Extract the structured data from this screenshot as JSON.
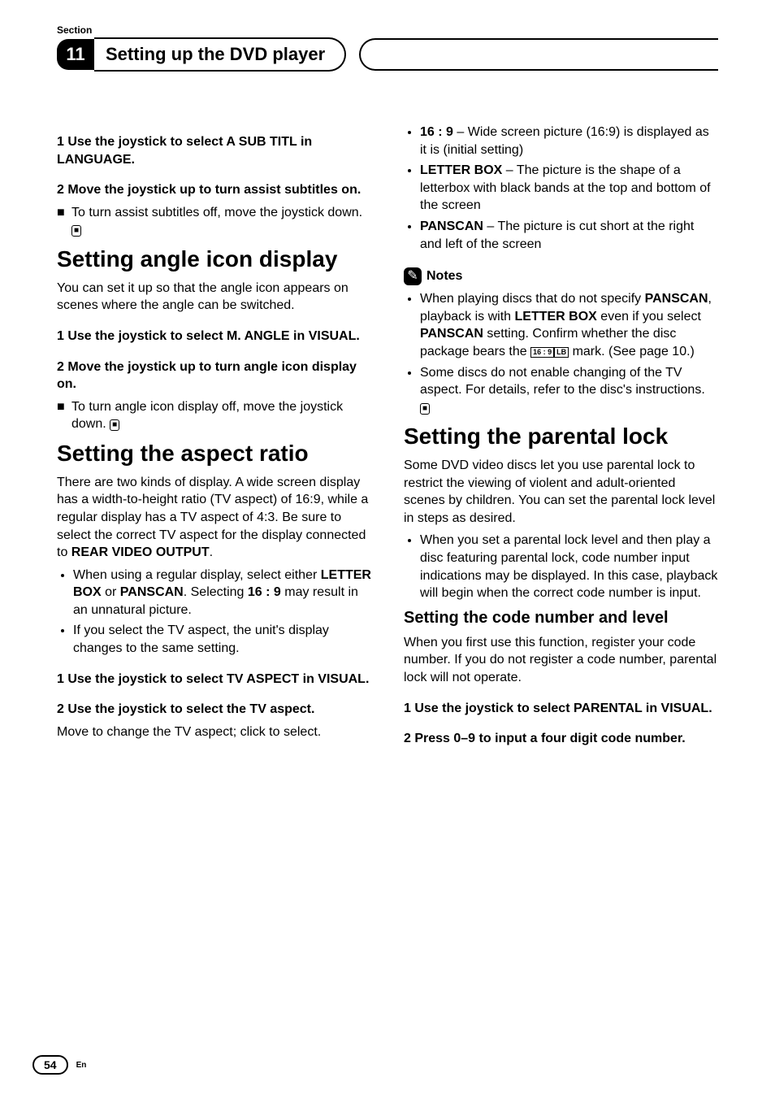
{
  "header": {
    "section_label": "Section",
    "section_number": "11",
    "chapter_title": "Setting up the DVD player"
  },
  "left": {
    "step_a_lead": "1     Use the joystick to select A SUB TITL in LANGUAGE.",
    "step_b_lead": "2     Move the joystick up to turn assist subtitles on.",
    "step_b_sub": "To turn assist subtitles off, move the joystick down.",
    "angle_h": "Setting angle icon display",
    "angle_intro": "You can set it up so that the angle icon appears on scenes where the angle can be switched.",
    "angle_s1": "1     Use the joystick to select M. ANGLE in VISUAL.",
    "angle_s2": "2     Move the joystick up to turn angle icon display on.",
    "angle_s2_sub": "To turn angle icon display off, move the joystick down.",
    "aspect_h": "Setting the aspect ratio",
    "aspect_p1a": "There are two kinds of display. A wide screen display has a width-to-height ratio (TV aspect) of 16:9, while a regular display has a TV aspect of 4:3. Be sure to select the correct TV aspect for the display connected to ",
    "aspect_p1b": "REAR VIDEO OUTPUT",
    "aspect_p1c": ".",
    "aspect_b1a": "When using a regular display, select either ",
    "aspect_b1b": "LETTER BOX",
    "aspect_b1c": " or ",
    "aspect_b1d": "PANSCAN",
    "aspect_b1e": ". Selecting ",
    "aspect_b1f": "16 : 9",
    "aspect_b1g": " may result in an unnatural picture.",
    "aspect_b2": "If you select the TV aspect, the unit's display changes to the same setting.",
    "aspect_s1": "1     Use the joystick to select TV ASPECT in VISUAL.",
    "aspect_s2": "2     Use the joystick to select the TV aspect.",
    "aspect_s2_sub": "Move to change the TV aspect; click to select."
  },
  "right": {
    "opt1a": "16 : 9",
    "opt1b": " – Wide screen picture (16:9) is displayed as it is (initial setting)",
    "opt2a": "LETTER BOX",
    "opt2b": " – The picture is the shape of a letterbox with black bands at the top and bottom of the screen",
    "opt3a": "PANSCAN",
    "opt3b": " – The picture is cut short at the right and left of the screen",
    "notes_label": "Notes",
    "note1a": "When playing discs that do not specify ",
    "note1b": "PANSCAN",
    "note1c": ", playback is with ",
    "note1d": "LETTER BOX",
    "note1e": " even if you select ",
    "note1f": "PANSCAN",
    "note1g": " setting. Confirm whether the disc package bears the ",
    "note1_icon1": "16 : 9",
    "note1_icon2": "LB",
    "note1h": " mark. (See page 10.)",
    "note2": "Some discs do not enable changing of the TV aspect. For details, refer to the disc's instructions.",
    "parent_h": "Setting the parental lock",
    "parent_intro": "Some DVD video discs let you use parental lock to restrict the viewing of violent and adult-oriented scenes by children. You can set the parental lock level in steps as desired.",
    "parent_b1": "When you set a parental lock level and then play a disc featuring parental lock, code number input indications may be displayed. In this case, playback will begin when the correct code number is input.",
    "parent_sub_h": "Setting the code number and level",
    "parent_sub_intro": "When you first use this function, register your code number. If you do not register a code number, parental lock will not operate.",
    "parent_s1": "1     Use the joystick to select PARENTAL in VISUAL.",
    "parent_s2": "2     Press 0–9 to input a four digit code number."
  },
  "footer": {
    "page_num": "54",
    "lang": "En"
  }
}
